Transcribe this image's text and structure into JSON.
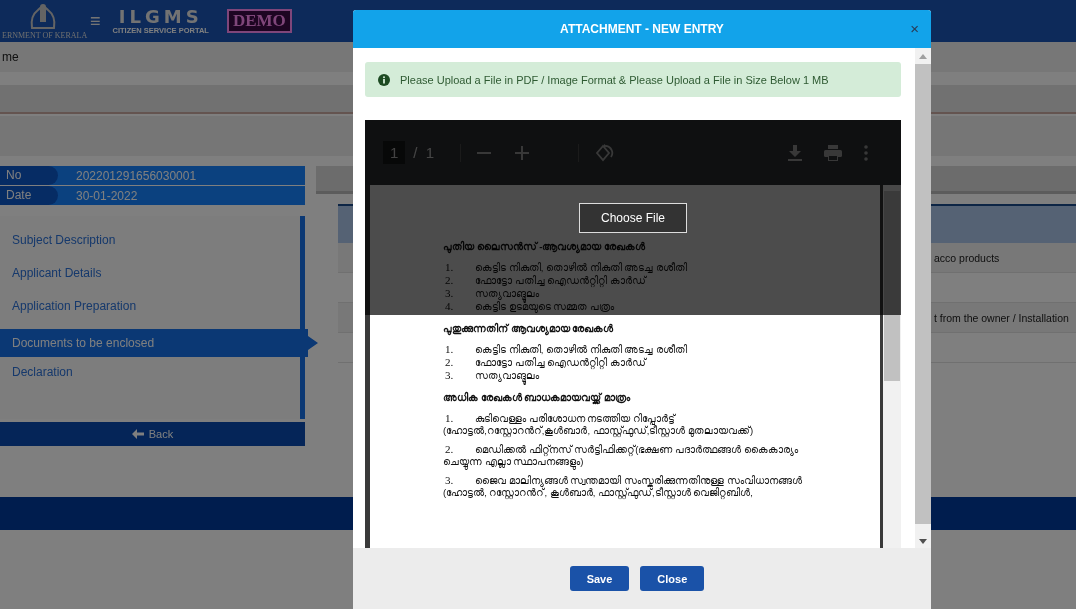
{
  "header": {
    "emblem_caption": "ERNMENT OF KERALA",
    "menu_icon": "≡",
    "logo_title": "ILGMS",
    "logo_subtitle": "CITIZEN SERVICE PORTAL",
    "stamp": "DEMO"
  },
  "breadcrumb": "me",
  "application": {
    "fields": [
      {
        "label": "No",
        "value": "202201291656030001"
      },
      {
        "label": "Date",
        "value": "30-01-2022"
      }
    ]
  },
  "steps": [
    {
      "label": "Subject Description",
      "selected": false
    },
    {
      "label": "Applicant Details",
      "selected": false
    },
    {
      "label": "Application Preparation",
      "selected": false
    },
    {
      "label": "Documents to be enclosed",
      "selected": true
    },
    {
      "label": "Declaration",
      "selected": false
    }
  ],
  "back_button": "Back",
  "table": {
    "rows": [
      {
        "column_3": "acco products"
      },
      {},
      {
        "column_3": "t from the owner / Installation"
      },
      {}
    ]
  },
  "modal": {
    "title": "ATTACHMENT - NEW ENTRY",
    "close": "×",
    "alert": "Please Upload a File in PDF / Image Format & Please Upload a File in Size Below 1 MB",
    "viewer": {
      "page": "1",
      "page_count": "/ 1"
    },
    "choose_file": "Choose File",
    "document": [
      {
        "heading": "പുതിയ ലൈസൻസ് -ആവശ്യമായ രേഖകൾ",
        "items": [
          {
            "number": "1.",
            "text": "കെട്ടിട നികുതി, തൊഴിൽ നികുതി അടച്ച രശീതി"
          },
          {
            "number": "2.",
            "text": "ഫോട്ടോ പതിച്ച ഐഡൻറ്റിറ്റി കാർഡ്"
          },
          {
            "number": "3.",
            "text": "സത്യവാങ്മൂലം"
          },
          {
            "number": "4.",
            "text": "കെട്ടിട ഉടമയുടെ സമ്മത പത്രം"
          }
        ]
      },
      {
        "heading": "പുതുക്കുന്നതിന് ആവശ്യമായ രേഖകൾ",
        "items": [
          {
            "number": "1.",
            "text": "കെട്ടിട നികുതി, തൊഴിൽ നികുതി അടച്ച രശീതി"
          },
          {
            "number": "2.",
            "text": "ഫോട്ടോ പതിച്ച ഐഡൻറ്റിറ്റി കാർഡ്"
          },
          {
            "number": "3.",
            "text": "സത്യവാങ്മൂലം"
          }
        ]
      },
      {
        "heading": "അധിക രേഖകൾ ബാധകമായവയ്ക്ക് മാത്രം",
        "items": [
          {
            "number": "1.",
            "text": "കുടിവെള്ളം പരിശോധന നടത്തിയ റിപ്പോർട്ട്",
            "continuation": "(ഹോട്ടൽ,റസ്റ്റോറൻറ്,കൂൾബാർ, ഫാസ്റ്റ്ഫുഡ്,ടീസ്റ്റാൾ മുതലായവക്ക്)"
          },
          {
            "number": "2.",
            "text": "മെഡിക്കൽ ഫിറ്റ്നസ് സർട്ടിഫിക്കറ്റ്(ഭക്ഷണ പദാർത്ഥങ്ങൾ കൈകാര്യം",
            "continuation": "ചെയ്യുന്ന എല്ലാ സ്ഥാപനങ്ങളും)"
          },
          {
            "number": "3.",
            "text": "ജൈവ മാലിന്യങ്ങൾ സ്വന്തമായി സംസ്കരിക്കുന്നതിനുള്ള സംവിധാനങ്ങൾ",
            "continuation": "(ഹോട്ടൽ, റസ്റ്റോറൻറ്, കൂൾബാർ, ഫാസ്റ്റ്ഫുഡ്,ടീസ്റ്റാൾ വെജിറ്റബിൾ,"
          }
        ]
      }
    ],
    "buttons": [
      {
        "label": "Save"
      },
      {
        "label": "Close"
      }
    ]
  }
}
